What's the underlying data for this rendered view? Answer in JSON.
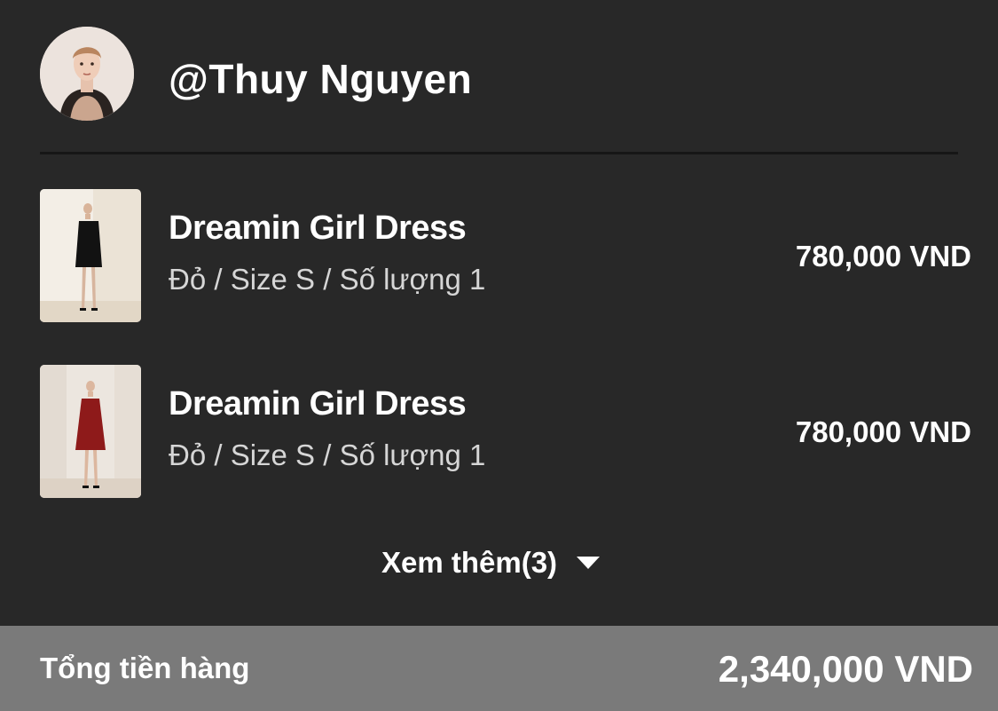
{
  "header": {
    "username": "@Thuy Nguyen",
    "avatar_icon": "user-avatar-photo"
  },
  "items": [
    {
      "name": "Dreamin Girl Dress",
      "variant": "Đỏ / Size S / Số lượng 1",
      "price": "780,000 VND",
      "dress_color": "#111111"
    },
    {
      "name": "Dreamin Girl Dress",
      "variant": "Đỏ / Size S / Số lượng 1",
      "price": "780,000 VND",
      "dress_color": "#8e1a1a"
    }
  ],
  "see_more": {
    "label": "Xem thêm(3)",
    "icon": "caret-down-icon"
  },
  "summary": {
    "label": "Tổng tiền hàng",
    "total": "2,340,000 VND"
  },
  "colors": {
    "background": "#282828",
    "divider": "#161616",
    "footer_bg": "#7a7a7a",
    "text_primary": "#ffffff",
    "text_secondary": "#d6d6d6"
  }
}
